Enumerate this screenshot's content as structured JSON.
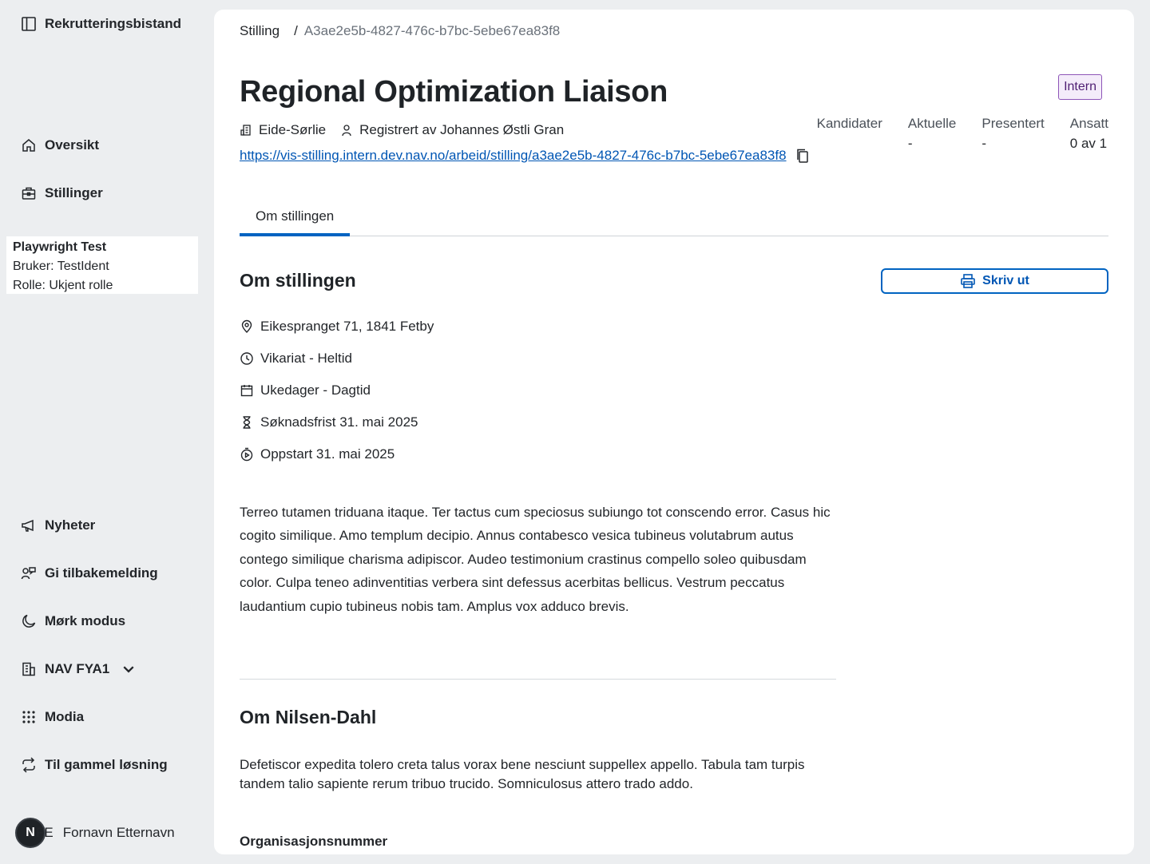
{
  "sidebar": {
    "brand": "Rekrutteringsbistand",
    "nav_top": [
      {
        "label": "Oversikt",
        "icon": "house-icon"
      },
      {
        "label": "Stillinger",
        "icon": "briefcase-icon"
      }
    ],
    "user": {
      "name": "Playwright Test",
      "ident": "Bruker: TestIdent",
      "role": "Rolle: Ukjent rolle"
    },
    "nav_bottom": [
      {
        "label": "Nyheter",
        "icon": "megaphone-icon"
      },
      {
        "label": "Gi tilbakemelding",
        "icon": "feedback-icon"
      },
      {
        "label": "Mørk modus",
        "icon": "moon-icon"
      },
      {
        "label": "NAV FYA1",
        "icon": "building-icon"
      },
      {
        "label": "Modia",
        "icon": "grid-icon"
      },
      {
        "label": "Til gammel løsning",
        "icon": "arrows-cycle-icon"
      }
    ],
    "profile": {
      "avatar_letter": "N",
      "initials": "FE",
      "name": "Fornavn Etternavn"
    }
  },
  "breadcrumb": {
    "parent": "Stilling",
    "separator": "/",
    "current": "A3ae2e5b-4827-476c-b7bc-5ebe67ea83f8"
  },
  "job": {
    "title": "Regional Optimization Liaison",
    "badge": "Intern",
    "employer": "Eide-Sørlie",
    "registered_by": "Registrert av Johannes Østli Gran",
    "url": "https://vis-stilling.intern.dev.nav.no/arbeid/stilling/a3ae2e5b-4827-476c-b7bc-5ebe67ea83f8"
  },
  "stats": [
    {
      "label": "Kandidater",
      "value": ""
    },
    {
      "label": "Aktuelle",
      "value": "-"
    },
    {
      "label": "Presentert",
      "value": "-"
    },
    {
      "label": "Ansatt",
      "value": "0 av 1"
    }
  ],
  "tabs": [
    "Om stillingen"
  ],
  "section": {
    "heading": "Om stillingen",
    "print_label": "Skriv ut",
    "info": [
      {
        "text": "Eikespranget 71, 1841 Fetby",
        "icon": "location-pin-icon"
      },
      {
        "text": "Vikariat - Heltid",
        "icon": "clock-icon"
      },
      {
        "text": "Ukedager - Dagtid",
        "icon": "calendar-icon"
      },
      {
        "text": "Søknadsfrist 31. mai 2025",
        "icon": "hourglass-icon"
      },
      {
        "text": "Oppstart 31. mai 2025",
        "icon": "timer-icon"
      }
    ],
    "description": "Terreo tutamen triduana itaque. Ter tactus cum speciosus subiungo tot conscendo error. Casus hic cogito similique. Amo templum decipio. Annus contabesco vesica tubineus volutabrum autus contego similique charisma adipiscor. Audeo testimonium crastinus compello soleo quibusdam color. Culpa teneo adinventitias verbera sint defessus acerbitas bellicus. Vestrum peccatus laudantium cupio tubineus nobis tam. Amplus vox adduco brevis."
  },
  "employer_section": {
    "heading": "Om Nilsen-Dahl",
    "description": "Defetiscor expedita tolero creta talus vorax bene nesciunt suppellex appello. Tabula tam turpis tandem talio sapiente rerum tribuo trucido. Somniculosus attero trado addo.",
    "org_label": "Organisasjonsnummer"
  }
}
